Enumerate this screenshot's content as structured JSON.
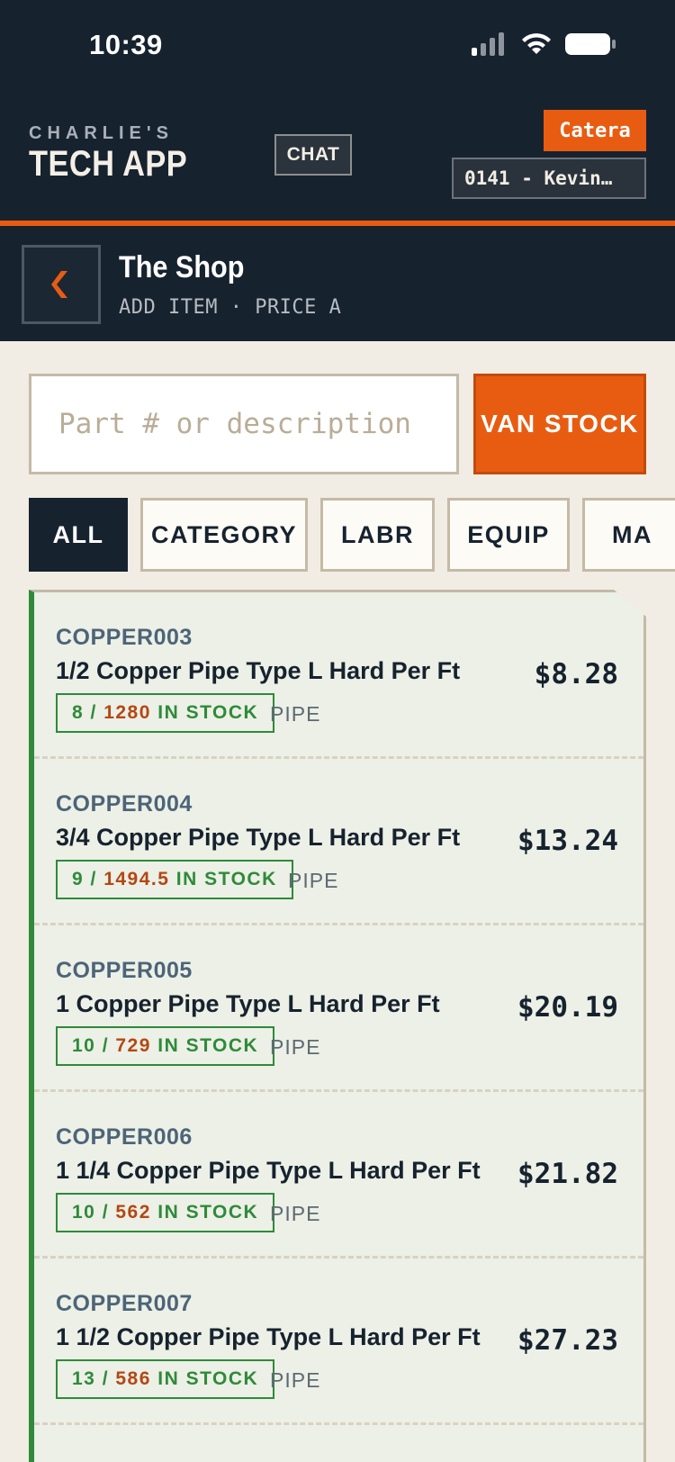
{
  "status_bar": {
    "time": "10:39"
  },
  "header": {
    "brand_small": "CHARLIE'S",
    "brand_big": "TECH APP",
    "chat_label": "CHAT",
    "company_badge": "Catera",
    "tech_select_value": "0141 - Kevin…",
    "accent_color": "#e85c12",
    "bar_color": "#17222f"
  },
  "subheader": {
    "back_icon": "chevron-left-icon",
    "title": "The Shop",
    "subtitle": "ADD ITEM · PRICE A"
  },
  "search": {
    "placeholder": "Part # or description",
    "value": "",
    "van_stock_label": "VAN STOCK"
  },
  "filters": [
    {
      "label": "ALL",
      "active": true
    },
    {
      "label": "CATEGORY",
      "active": false
    },
    {
      "label": "LABR",
      "active": false
    },
    {
      "label": "EQUIP",
      "active": false
    },
    {
      "label": "MA",
      "active": false
    }
  ],
  "items": [
    {
      "sku": "COPPER003",
      "description": "1/2 Copper Pipe Type L Hard Per Ft",
      "price": "$8.28",
      "van_qty": "8",
      "total_qty": "1280",
      "stock_suffix": "IN STOCK",
      "category": "PIPE"
    },
    {
      "sku": "COPPER004",
      "description": "3/4 Copper Pipe Type L Hard Per Ft",
      "price": "$13.24",
      "van_qty": "9",
      "total_qty": "1494.5",
      "stock_suffix": "IN STOCK",
      "category": "PIPE"
    },
    {
      "sku": "COPPER005",
      "description": "1 Copper Pipe Type L Hard Per Ft",
      "price": "$20.19",
      "van_qty": "10",
      "total_qty": "729",
      "stock_suffix": "IN STOCK",
      "category": "PIPE"
    },
    {
      "sku": "COPPER006",
      "description": "1 1/4 Copper Pipe Type L Hard Per Ft",
      "price": "$21.82",
      "van_qty": "10",
      "total_qty": "562",
      "stock_suffix": "IN STOCK",
      "category": "PIPE"
    },
    {
      "sku": "COPPER007",
      "description": "1 1/2 Copper Pipe Type L Hard Per Ft",
      "price": "$27.23",
      "van_qty": "13",
      "total_qty": "586",
      "stock_suffix": "IN STOCK",
      "category": "PIPE"
    }
  ]
}
